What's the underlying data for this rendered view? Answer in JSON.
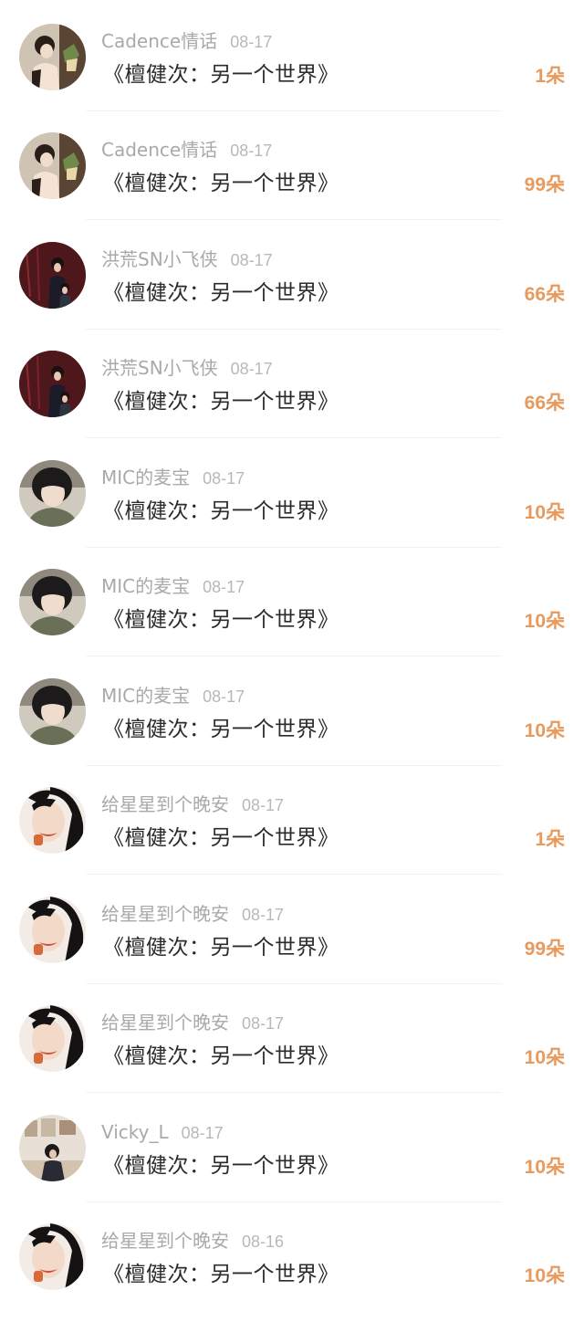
{
  "gifts": [
    {
      "name": "Cadence情话",
      "date": "08-17",
      "title": "《檀健次：另一个世界》",
      "count": "1朵",
      "avatar": "avatar-cadence"
    },
    {
      "name": "Cadence情话",
      "date": "08-17",
      "title": "《檀健次：另一个世界》",
      "count": "99朵",
      "avatar": "avatar-cadence"
    },
    {
      "name": "洪荒SN小飞侠",
      "date": "08-17",
      "title": "《檀健次：另一个世界》",
      "count": "66朵",
      "avatar": "avatar-hongmeng"
    },
    {
      "name": "洪荒SN小飞侠",
      "date": "08-17",
      "title": "《檀健次：另一个世界》",
      "count": "66朵",
      "avatar": "avatar-hongmeng"
    },
    {
      "name": "MIC的麦宝",
      "date": "08-17",
      "title": "《檀健次：另一个世界》",
      "count": "10朵",
      "avatar": "avatar-mic"
    },
    {
      "name": "MIC的麦宝",
      "date": "08-17",
      "title": "《檀健次：另一个世界》",
      "count": "10朵",
      "avatar": "avatar-mic"
    },
    {
      "name": "MIC的麦宝",
      "date": "08-17",
      "title": "《檀健次：另一个世界》",
      "count": "10朵",
      "avatar": "avatar-mic"
    },
    {
      "name": "给星星到个晚安",
      "date": "08-17",
      "title": "《檀健次：另一个世界》",
      "count": "1朵",
      "avatar": "avatar-star"
    },
    {
      "name": "给星星到个晚安",
      "date": "08-17",
      "title": "《檀健次：另一个世界》",
      "count": "99朵",
      "avatar": "avatar-star"
    },
    {
      "name": "给星星到个晚安",
      "date": "08-17",
      "title": "《檀健次：另一个世界》",
      "count": "10朵",
      "avatar": "avatar-star"
    },
    {
      "name": "Vicky_L",
      "date": "08-17",
      "title": "《檀健次：另一个世界》",
      "count": "10朵",
      "avatar": "avatar-vicky"
    },
    {
      "name": "给星星到个晚安",
      "date": "08-16",
      "title": "《檀健次：另一个世界》",
      "count": "10朵",
      "avatar": "avatar-star"
    }
  ],
  "colors": {
    "name": "#a9a9a9",
    "date": "#b8b8b8",
    "title": "#2b2b2b",
    "count": "#e8995c"
  }
}
